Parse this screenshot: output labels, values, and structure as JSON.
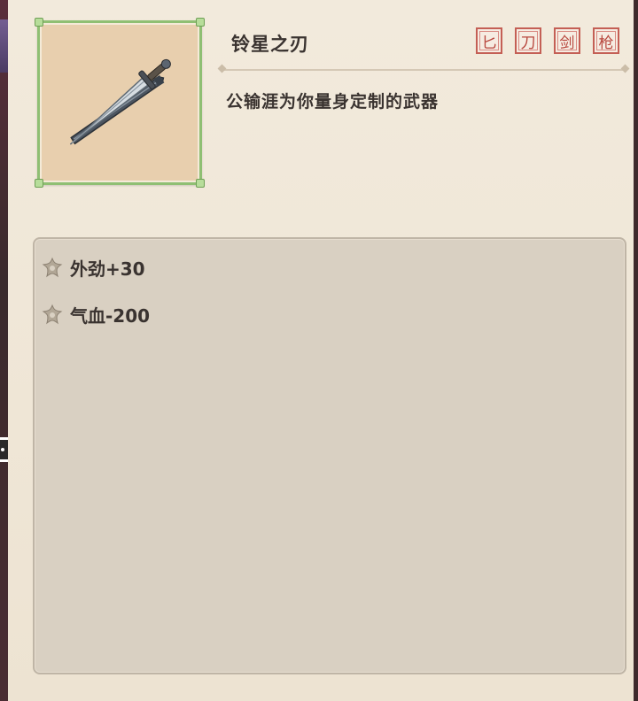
{
  "item": {
    "name": "铃星之刃",
    "description": "公输涯为你量身定制的武器",
    "icon": "sword-icon",
    "weapon_tags": [
      {
        "id": "dagger",
        "label": "匕"
      },
      {
        "id": "blade",
        "label": "刀"
      },
      {
        "id": "sword",
        "label": "剑"
      },
      {
        "id": "spear",
        "label": "枪"
      }
    ],
    "stats": [
      {
        "label": "外劲+30"
      },
      {
        "label": "气血-200"
      }
    ]
  },
  "colors": {
    "frame_border": "#8fbf73",
    "tag_red": "#c45f55",
    "text": "#3a3330",
    "panel_bg": "#efe6d6"
  }
}
